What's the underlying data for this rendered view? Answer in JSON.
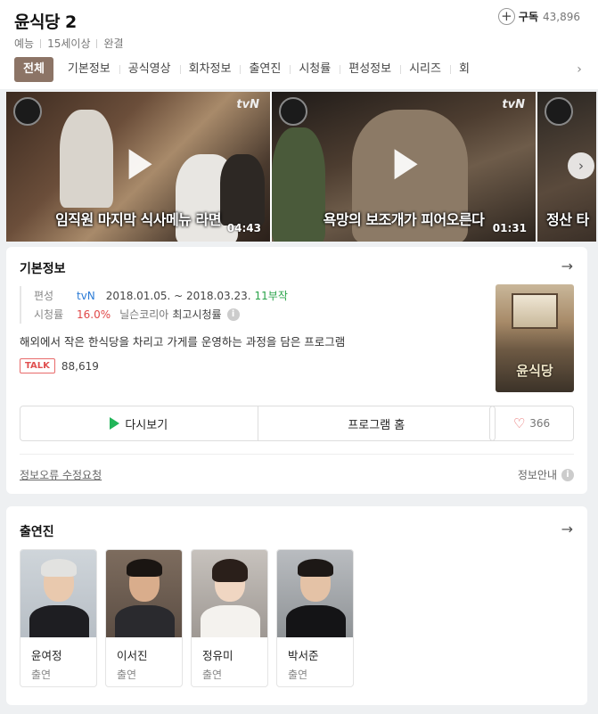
{
  "header": {
    "title": "윤식당 2",
    "meta": [
      "예능",
      "15세이상",
      "완결"
    ],
    "subscribe_label": "구독",
    "subscribe_count": "43,896"
  },
  "tabs": [
    "전체",
    "기본정보",
    "공식영상",
    "회차정보",
    "출연진",
    "시청률",
    "편성정보",
    "시리즈",
    "회"
  ],
  "videos": [
    {
      "caption": "임직원 마지막 식사메뉴 라면",
      "duration": "04:43",
      "channel": "tvN"
    },
    {
      "caption": "욕망의 보조개가 피어오른다",
      "duration": "01:31",
      "channel": "tvN"
    },
    {
      "caption": "정산 타",
      "duration": "",
      "channel": ""
    }
  ],
  "info": {
    "section_title": "기본정보",
    "label_broadcast": "편성",
    "channel": "tvN",
    "dates": "2018.01.05. ~ 2018.03.23.",
    "episodes": "11부작",
    "label_rating": "시청률",
    "rating": "16.0%",
    "rating_source": "닐슨코리아",
    "rating_note": "최고시청률",
    "description": "해외에서 작은 한식당을 차리고 가게를 운영하는 과정을 담은 프로그램",
    "talk_badge": "TALK",
    "talk_count": "88,619",
    "poster_title": "윤식당",
    "btn_watch": "다시보기",
    "btn_home": "프로그램 홈",
    "like_count": "366",
    "error_link": "정보오류 수정요청",
    "info_guide": "정보안내"
  },
  "cast": {
    "section_title": "출연진",
    "members": [
      {
        "name": "윤여정",
        "role": "출연"
      },
      {
        "name": "이서진",
        "role": "출연"
      },
      {
        "name": "정유미",
        "role": "출연"
      },
      {
        "name": "박서준",
        "role": "출연"
      }
    ]
  },
  "icons": {
    "arrow": "→",
    "chevron_right": "›",
    "heart": "♡",
    "plus": "+",
    "info": "i"
  },
  "colors": {
    "active_tab": "#8c7466",
    "channel_link": "#2b7bd6",
    "episodes": "#2aa34a",
    "rating": "#e04848",
    "talk": "#e05050",
    "watch_icon": "#21b559"
  }
}
